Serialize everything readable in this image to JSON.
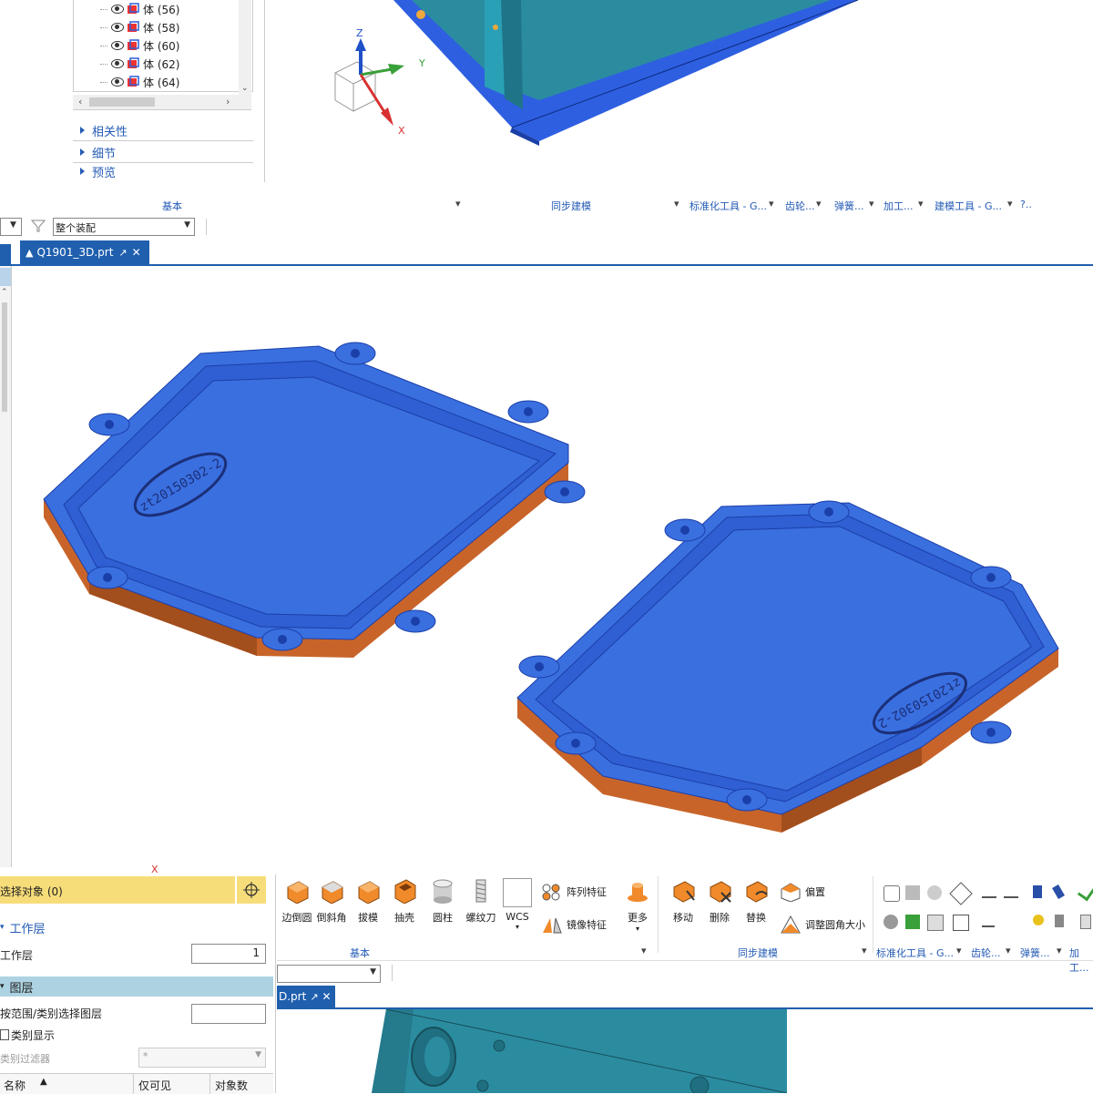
{
  "top_nav": {
    "tree_items": [
      {
        "label": "体 (56)"
      },
      {
        "label": "体 (58)"
      },
      {
        "label": "体 (60)"
      },
      {
        "label": "体 (62)"
      },
      {
        "label": "体 (64)"
      }
    ],
    "sections": [
      "相关性",
      "细节",
      "预览"
    ]
  },
  "ribbon_top": {
    "groups": [
      "基本",
      "同步建模",
      "标准化工具 - G...",
      "齿轮...",
      "弹簧...",
      "加工...",
      "建模工具 - G...",
      "?.."
    ],
    "filter_value": "整个装配"
  },
  "tab_main": {
    "title": "Q1901_3D.prt"
  },
  "axes": {
    "z": "Z",
    "y": "Y",
    "x": "X"
  },
  "part_labels": [
    "zt20150302-2",
    "zt20150302-2"
  ],
  "layer_panel": {
    "select_object": "选择对象 (0)",
    "work_layer_section": "工作层",
    "work_layer_label": "工作层",
    "work_layer_value": "1",
    "layers_section": "图层",
    "range_label": "按范围/类别选择图层",
    "category_display": "类别显示",
    "category_filter_label": "类别过滤器",
    "category_filter_value": "*",
    "table_headers": [
      "名称",
      "仅可见",
      "对象数"
    ]
  },
  "ribbon_bottom": {
    "buttons": [
      "边倒圆",
      "倒斜角",
      "拔模",
      "抽壳",
      "圆柱",
      "螺纹刀",
      "WCS",
      "更多",
      "移动",
      "删除",
      "替换"
    ],
    "feature_buttons": [
      "阵列特征",
      "镜像特征"
    ],
    "sync_buttons": [
      "偏置",
      "调整圆角大小"
    ],
    "groups": [
      "基本",
      "同步建模",
      "标准化工具 - G...",
      "齿轮...",
      "弹簧...",
      "加工..."
    ]
  },
  "tab_bottom": {
    "title": "D.prt"
  },
  "colors": {
    "part_top": "#3a6fe0",
    "part_side": "#c8642a",
    "mold_teal": "#2b8ca0",
    "accent_blue": "#1f5fae",
    "yellow_bar": "#f7dd7a"
  }
}
